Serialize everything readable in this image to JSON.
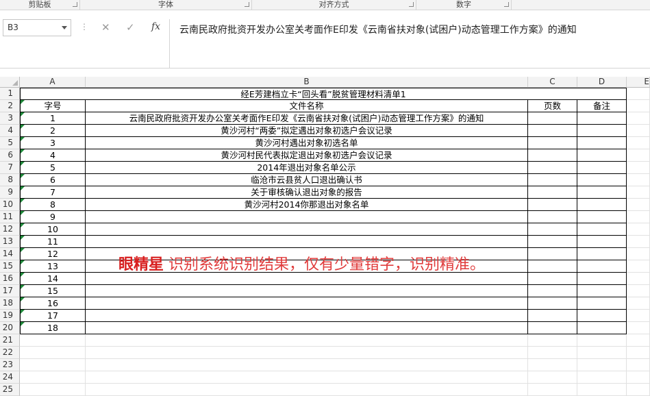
{
  "ribbon": {
    "groups": [
      "剪贴板",
      "字体",
      "对齐方式",
      "数字"
    ]
  },
  "namebox": {
    "value": "B3"
  },
  "formula_bar": {
    "fx_label": "fx",
    "content": "云南民政府批资开发办公室关考面作E印发《云南省扶对象(试困户)动态管理工作方案》的通知"
  },
  "columns": [
    "A",
    "B",
    "C",
    "D",
    "E"
  ],
  "row_numbers": [
    "1",
    "2",
    "3",
    "4",
    "5",
    "6",
    "7",
    "8",
    "9",
    "10",
    "11",
    "12",
    "13",
    "14",
    "15",
    "16",
    "17",
    "18",
    "19",
    "20",
    "21",
    "22",
    "23",
    "24",
    "25"
  ],
  "sheet": {
    "title": "经E芳建档立卡“回头看”脱贫管理材料清单1",
    "headers": [
      "字号",
      "文件名称",
      "页数",
      "备注"
    ],
    "rows": [
      [
        "1",
        "云南民政府批资开发办公室关考面作E印发《云南省扶对象(试困户)动态管理工作方案》的通知"
      ],
      [
        "2",
        "黄沙河村“两委”拟定遇出对象初选户会议记录"
      ],
      [
        "3",
        "黄沙河村遇出对象初选名单"
      ],
      [
        "4",
        "黄沙河村民代表拟定退出对象初选户会议记录"
      ],
      [
        "5",
        "2014年退出对象名单公示"
      ],
      [
        "6",
        "临沧市云县贫人口退出确认书"
      ],
      [
        "7",
        "关于审核确认退出对象的报告"
      ],
      [
        "8",
        "黄沙河村2014你那退出对象名单"
      ],
      [
        "9",
        ""
      ],
      [
        "10",
        ""
      ],
      [
        "11",
        ""
      ],
      [
        "12",
        ""
      ],
      [
        "13",
        ""
      ],
      [
        "14",
        ""
      ],
      [
        "15",
        ""
      ],
      [
        "16",
        ""
      ],
      [
        "17",
        ""
      ],
      [
        "18",
        ""
      ]
    ]
  },
  "overlay": {
    "brand": "眼精星",
    "text": " 识别系统识别结果，仅有少量错字，识别精准。"
  },
  "colors": {
    "error_indicator": "#1f8a3a",
    "overlay_text": "#e03c3c"
  }
}
